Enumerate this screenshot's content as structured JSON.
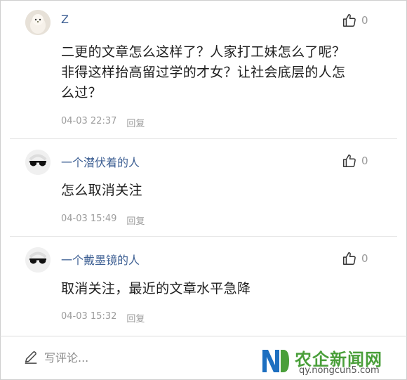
{
  "comments": [
    {
      "username": "Z",
      "avatar_icon": "dog-avatar",
      "like_count": "0",
      "text_lines": [
        "二更的文章怎么这样了？人家打工妹怎么了呢？",
        "非得这样抬高留过学的才女？让社会底层的人怎",
        "么过？"
      ],
      "timestamp": "04-03 22:37",
      "reply_label": "回复"
    },
    {
      "username": "一个潜伏着的人",
      "avatar_icon": "sunglasses-avatar",
      "like_count": "0",
      "text_lines": [
        "怎么取消关注"
      ],
      "timestamp": "04-03 15:49",
      "reply_label": "回复"
    },
    {
      "username": "一个戴墨镜的人",
      "avatar_icon": "sunglasses-avatar",
      "like_count": "0",
      "text_lines": [
        "取消关注，最近的文章水平急降"
      ],
      "timestamp": "04-03 15:32",
      "reply_label": "回复"
    }
  ],
  "footer": {
    "write_placeholder": "写评论...",
    "write_icon": "pencil-icon"
  },
  "watermark": {
    "name": "农企新闻网",
    "url": "qy.nongcun5.com",
    "brand_color": "#4a9f3a"
  }
}
